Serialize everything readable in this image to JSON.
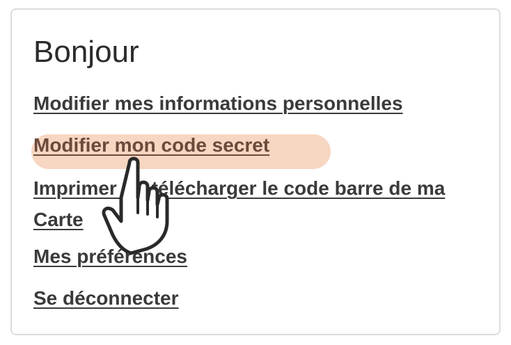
{
  "greeting": "Bonjour",
  "menu": {
    "items": [
      {
        "label": "Modifier mes informations personnelles"
      },
      {
        "label": "Modifier mon code secret"
      },
      {
        "label": "Imprimer ou télécharger le code barre de ma Carte"
      },
      {
        "label": "Mes préférences"
      },
      {
        "label": "Se déconnecter"
      }
    ]
  },
  "colors": {
    "highlight": "#f7d6c2",
    "link_text": "#3a3a3a",
    "border": "#dcdcdc"
  },
  "icons": {
    "cursor": "pointing-hand-icon"
  }
}
